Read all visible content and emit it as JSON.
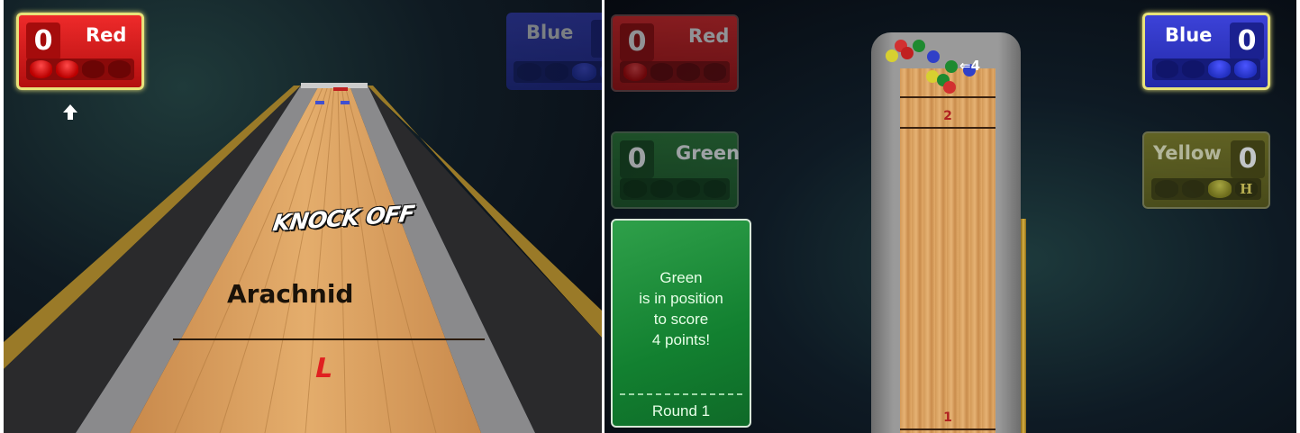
{
  "left_view": {
    "players": {
      "red": {
        "name": "Red",
        "score": "0"
      },
      "blue": {
        "name": "Blue"
      }
    },
    "lane": {
      "logo_top": "KNOCK OFF",
      "logo_bottom": "Arachnid",
      "shooter_mark": "L"
    }
  },
  "right_view": {
    "players": {
      "red": {
        "name": "Red",
        "score": "0"
      },
      "green": {
        "name": "Green",
        "score": "0"
      },
      "blue": {
        "name": "Blue",
        "score": "0"
      },
      "yellow": {
        "name": "Yellow",
        "score": "0",
        "hammer": "H"
      }
    },
    "message": {
      "text": "Green\nis in position\nto score\n4 points!",
      "round": "Round 1"
    },
    "table": {
      "zone_2": "2",
      "zone_1": "1",
      "points_label": "⇐4"
    }
  },
  "colors": {
    "red": "#e62020",
    "blue": "#2f36c8",
    "green": "#1d5a24",
    "yellow": "#6c6a1c",
    "wood": "#d9a062"
  }
}
